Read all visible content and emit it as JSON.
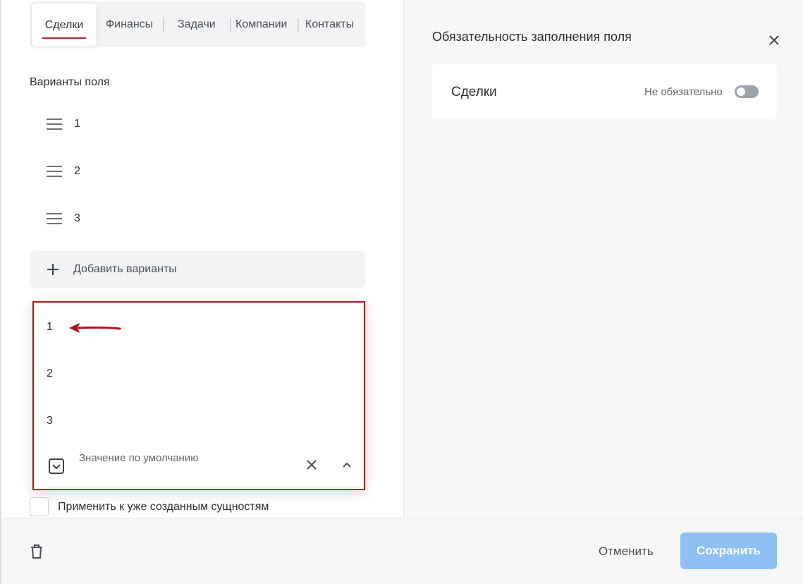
{
  "tabs": [
    {
      "label": "Сделки",
      "active": true
    },
    {
      "label": "Финансы",
      "active": false
    },
    {
      "label": "Задачи",
      "active": false
    },
    {
      "label": "Компании",
      "active": false
    },
    {
      "label": "Контакты",
      "active": false
    }
  ],
  "field_variants": {
    "title": "Варианты поля",
    "items": [
      "1",
      "2",
      "3"
    ],
    "add_label": "Добавить варианты"
  },
  "default_value_dropdown": {
    "options": [
      "1",
      "2",
      "3"
    ],
    "placeholder": "Значение по умолчанию",
    "highlight_color": "#b5121b"
  },
  "apply_existing": {
    "label": "Применить к уже созданным сущностям",
    "checked": false
  },
  "requirement_panel": {
    "title": "Обязательность заполнения поля",
    "entity": "Сделки",
    "state_label": "Не обязательно",
    "required": false
  },
  "footer": {
    "cancel_label": "Отменить",
    "save_label": "Сохранить"
  },
  "colors": {
    "accent_red": "#b02a2a",
    "save_button": "#8fc0f5",
    "panel_bg": "#f7f7f8"
  }
}
